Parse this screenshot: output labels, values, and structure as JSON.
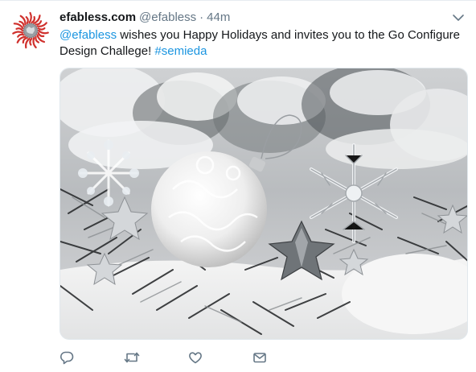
{
  "tweet": {
    "display_name": "efabless.com",
    "handle": "@efabless",
    "separator": "·",
    "timestamp": "44m",
    "text": {
      "mention": "@efabless",
      "body": " wishes you Happy Holidays and invites you to the Go Configure Design Challege! ",
      "hashtag": "#semieda"
    },
    "avatar_icon": "efabless-logo-icon",
    "menu_icon": "chevron-down-icon",
    "media_description_icon": "holiday-photo"
  },
  "actions": [
    {
      "name": "reply",
      "icon": "reply-icon"
    },
    {
      "name": "retweet",
      "icon": "retweet-icon"
    },
    {
      "name": "like",
      "icon": "heart-icon"
    },
    {
      "name": "message",
      "icon": "envelope-icon"
    }
  ],
  "colors": {
    "link": "#1b95e0",
    "secondary_text": "#657786",
    "brand_red": "#d0312d",
    "icon_gray": "#657786"
  }
}
